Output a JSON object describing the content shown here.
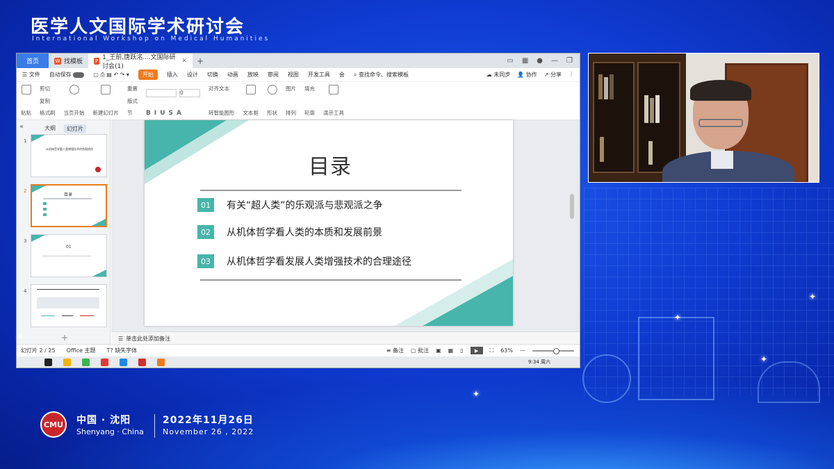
{
  "event": {
    "title_cn": "医学人文国际学术研讨会",
    "title_en": "International Workshop on Medical Humanities",
    "location_cn": "中国 · 沈阳",
    "location_en": "Shenyang · China",
    "date_cn": "2022年11月26日",
    "date_en": "November 26 , 2022"
  },
  "app": {
    "tabs": {
      "home": "首页",
      "template": "找模板",
      "doc": "1_王前,唐跃洺....文国际研讨会(1)"
    },
    "menu": {
      "file": "文件",
      "autosave": "自动保存",
      "start": "开始",
      "insert": "插入",
      "design": "设计",
      "transition": "切换",
      "animation": "动画",
      "slideshow": "放映",
      "review": "审阅",
      "view": "视图",
      "devtools": "开发工具",
      "member": "会",
      "search_placeholder": "查找命令、搜索模板",
      "sync": "未同步",
      "collab": "协作",
      "share": "分享"
    },
    "ribbon": {
      "paste": "粘贴",
      "cut": "剪切",
      "copy": "复制",
      "format_painter": "格式刷",
      "from_current": "当页开始",
      "new_slide": "新建幻灯片",
      "layout": "版式",
      "section": "节",
      "reset": "重置",
      "font_size": "0",
      "align_text": "对齐文本",
      "smartart": "转智能图形",
      "textbox": "文本框",
      "shape": "形状",
      "picture": "图片",
      "arrange": "排列",
      "fill": "填充",
      "outline": "轮廓",
      "present_tools": "演示工具"
    },
    "sidebar": {
      "outline": "大纲",
      "slides": "幻灯片",
      "thumbs": [
        {
          "num": "1",
          "text": "从机体哲学看人类增强技术的合理途径"
        },
        {
          "num": "2",
          "text": "目录"
        },
        {
          "num": "3",
          "text": "01"
        },
        {
          "num": "4",
          "text": ""
        }
      ]
    },
    "notes_placeholder": "单击此处添加备注",
    "status": {
      "slide_counter": "幻灯片 2 / 25",
      "theme": "Office 主题",
      "missing_font": "缺失字体",
      "notes": "备注",
      "comment": "批注",
      "zoom": "63%"
    },
    "clock": "9:34 周六"
  },
  "slide": {
    "title": "目录",
    "items": [
      {
        "num": "01",
        "text": "有关“超人类”的乐观派与悲观派之争"
      },
      {
        "num": "02",
        "text": "从机体哲学看人类的本质和发展前景"
      },
      {
        "num": "03",
        "text": "从机体哲学看发展人类增强技术的合理途径"
      }
    ]
  },
  "colors": {
    "accent_teal": "#47b5ab",
    "wps_orange": "#f07b1d",
    "bg_blue": "#0f3bd0"
  }
}
